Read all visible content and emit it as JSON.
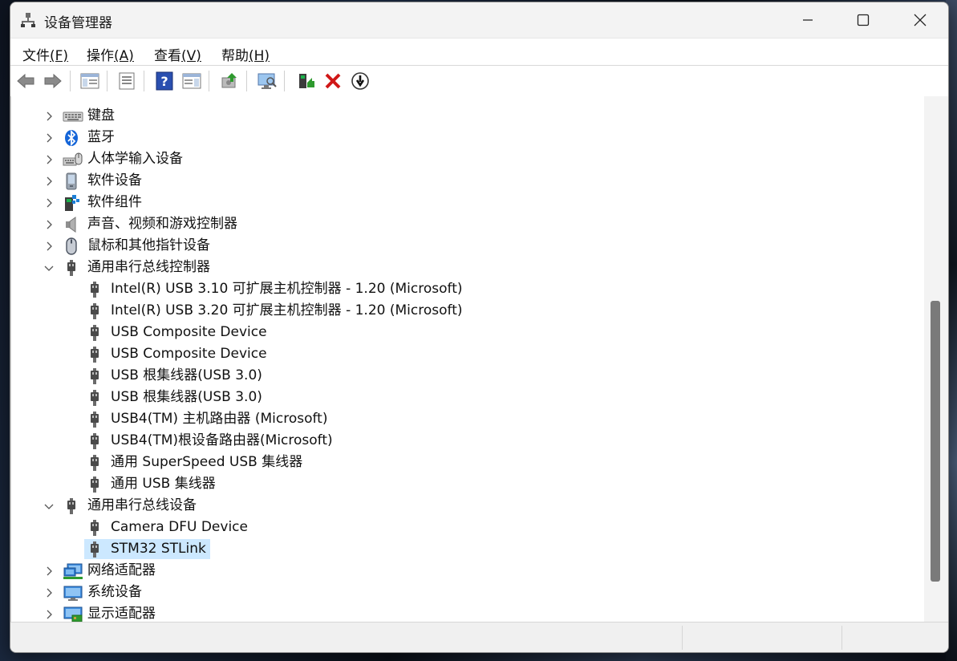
{
  "window": {
    "title": "设备管理器",
    "app_icon": "device-manager-icon"
  },
  "menu": {
    "items": [
      {
        "label": "文件",
        "mnemonic": "(F)"
      },
      {
        "label": "操作",
        "mnemonic": "(A)"
      },
      {
        "label": "查看",
        "mnemonic": "(V)"
      },
      {
        "label": "帮助",
        "mnemonic": "(H)"
      }
    ]
  },
  "toolbar": {
    "buttons": [
      "back-icon",
      "forward-icon",
      "show-hide-console-tree-icon",
      "properties-icon",
      "help-icon",
      "action-pane-icon",
      "update-driver-icon",
      "scan-hardware-icon",
      "enable-device-icon",
      "uninstall-device-icon",
      "disable-device-icon"
    ]
  },
  "tree": {
    "items": [
      {
        "label": "键盘",
        "level": 0,
        "expanded": false,
        "icon": "keyboard-icon"
      },
      {
        "label": "蓝牙",
        "level": 0,
        "expanded": false,
        "icon": "bluetooth-icon"
      },
      {
        "label": "人体学输入设备",
        "level": 0,
        "expanded": false,
        "icon": "hid-icon"
      },
      {
        "label": "软件设备",
        "level": 0,
        "expanded": false,
        "icon": "software-device-icon"
      },
      {
        "label": "软件组件",
        "level": 0,
        "expanded": false,
        "icon": "software-component-icon"
      },
      {
        "label": "声音、视频和游戏控制器",
        "level": 0,
        "expanded": false,
        "icon": "speaker-icon"
      },
      {
        "label": "鼠标和其他指针设备",
        "level": 0,
        "expanded": false,
        "icon": "mouse-icon"
      },
      {
        "label": "通用串行总线控制器",
        "level": 0,
        "expanded": true,
        "icon": "usb-icon"
      },
      {
        "label": "Intel(R) USB 3.10 可扩展主机控制器 - 1.20 (Microsoft)",
        "level": 1,
        "icon": "usb-icon"
      },
      {
        "label": "Intel(R) USB 3.20 可扩展主机控制器 - 1.20 (Microsoft)",
        "level": 1,
        "icon": "usb-icon"
      },
      {
        "label": "USB Composite Device",
        "level": 1,
        "icon": "usb-icon"
      },
      {
        "label": "USB Composite Device",
        "level": 1,
        "icon": "usb-icon"
      },
      {
        "label": "USB 根集线器(USB 3.0)",
        "level": 1,
        "icon": "usb-icon"
      },
      {
        "label": "USB 根集线器(USB 3.0)",
        "level": 1,
        "icon": "usb-icon"
      },
      {
        "label": "USB4(TM) 主机路由器 (Microsoft)",
        "level": 1,
        "icon": "usb-icon"
      },
      {
        "label": "USB4(TM)根设备路由器(Microsoft)",
        "level": 1,
        "icon": "usb-icon"
      },
      {
        "label": "通用 SuperSpeed USB 集线器",
        "level": 1,
        "icon": "usb-icon"
      },
      {
        "label": "通用 USB 集线器",
        "level": 1,
        "icon": "usb-icon"
      },
      {
        "label": "通用串行总线设备",
        "level": 0,
        "expanded": true,
        "icon": "usb-icon"
      },
      {
        "label": "Camera DFU Device",
        "level": 1,
        "icon": "usb-icon"
      },
      {
        "label": "STM32 STLink",
        "level": 1,
        "icon": "usb-icon",
        "selected": true
      },
      {
        "label": "网络适配器",
        "level": 0,
        "expanded": false,
        "icon": "network-adapter-icon"
      },
      {
        "label": "系统设备",
        "level": 0,
        "expanded": false,
        "icon": "system-device-icon"
      },
      {
        "label": "显示适配器",
        "level": 0,
        "expanded": false,
        "icon": "display-adapter-icon"
      }
    ]
  },
  "colors": {
    "selection": "#cce8ff",
    "scroll_thumb": "#7a7a7a"
  }
}
